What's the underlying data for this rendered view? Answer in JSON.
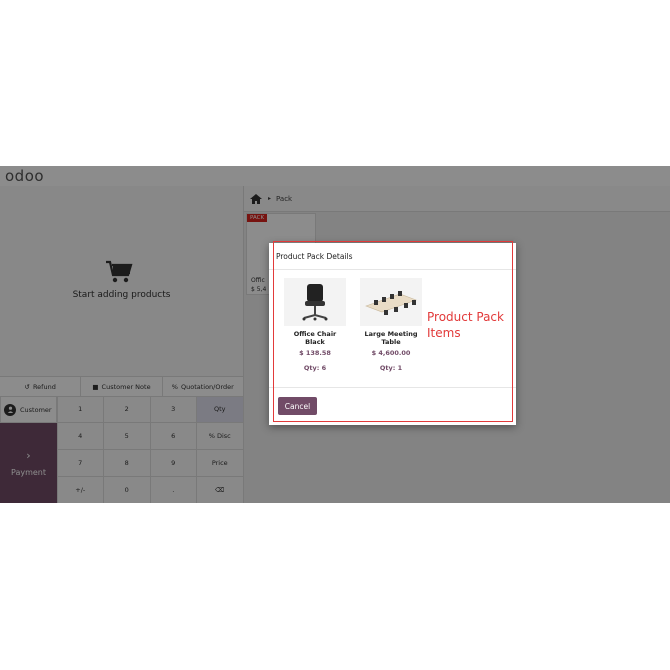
{
  "app": {
    "logo": "odoo"
  },
  "order": {
    "empty_text": "Start adding products"
  },
  "actions": [
    {
      "label": "Refund",
      "icon": "refund-icon"
    },
    {
      "label": "Customer Note",
      "icon": "note-icon"
    },
    {
      "label": "Quotation/Order",
      "icon": "percent-icon"
    }
  ],
  "numpad": {
    "customer_label": "Customer",
    "payment_label": "Payment",
    "keys": [
      "1",
      "2",
      "3",
      "Qty",
      "4",
      "5",
      "6",
      "% Disc",
      "7",
      "8",
      "9",
      "Price",
      "+/-",
      "0",
      ".",
      "⌫"
    ],
    "active_key": "Qty"
  },
  "breadcrumb": {
    "current": "Pack"
  },
  "product_card": {
    "tag": "PACK",
    "name": "Offic",
    "price": "$ 5,4"
  },
  "modal": {
    "title": "Product Pack Details",
    "items": [
      {
        "name": "Office Chair Black",
        "price": "$ 138.58",
        "qty": "Qty: 6"
      },
      {
        "name": "Large Meeting Table",
        "price": "$ 4,600.00",
        "qty": "Qty: 1"
      }
    ],
    "annotation": "Product Pack Items",
    "cancel_label": "Cancel"
  },
  "colors": {
    "brand": "#714b67",
    "highlight": "#e23a3a",
    "pack_tag": "#d9231e"
  }
}
